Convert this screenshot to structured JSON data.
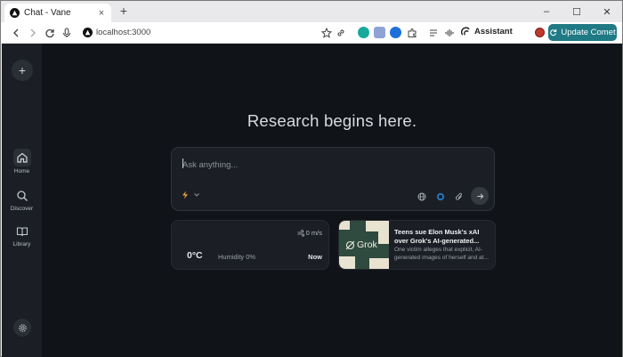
{
  "browser": {
    "tab_title": "Chat - Vane",
    "tab_close": "×",
    "new_tab": "+",
    "window_controls": [
      "–",
      "☐",
      "✕"
    ],
    "url": "localhost:3000",
    "assistant_label": "Assistant",
    "update_label": "Update Comet",
    "accent_color": "#1f7a85"
  },
  "sidebar": {
    "new_chat": "+",
    "items": [
      {
        "label": "Home",
        "icon": "home-icon"
      },
      {
        "label": "Discover",
        "icon": "search-icon"
      },
      {
        "label": "Library",
        "icon": "book-icon"
      }
    ],
    "settings_icon": "gear-icon"
  },
  "main": {
    "heading": "Research begins here.",
    "ask": {
      "placeholder": "Ask anything...",
      "mode_icon": "bolt-icon",
      "tools": [
        "globe-icon",
        "chip-icon",
        "paperclip-icon"
      ],
      "submit_icon": "arrow-right-icon"
    },
    "weather": {
      "wind": "0 m/s",
      "temperature": "0°C",
      "humidity": "Humidity 0%",
      "time": "Now"
    },
    "news": {
      "thumb_text": "Grok",
      "title": "Teens sue Elon Musk's xAI over Grok's AI-generated...",
      "snippet": "One victim alleges that explicit, AI-generated images of herself and at..."
    }
  }
}
